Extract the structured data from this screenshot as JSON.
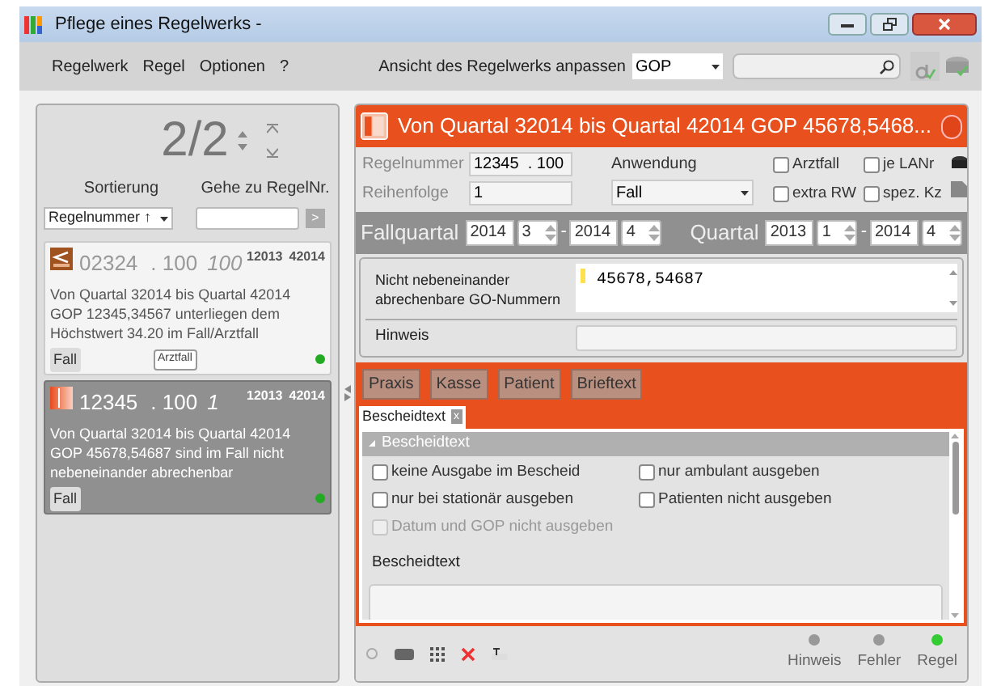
{
  "window": {
    "title": "Pflege eines Regelwerks -"
  },
  "menu": [
    {
      "label": "Regelwerk"
    },
    {
      "label": "Regel"
    },
    {
      "label": "Optionen"
    },
    {
      "label": "?"
    }
  ],
  "view": {
    "label": "Ansicht des Regelwerks anpassen",
    "value": "GOP"
  },
  "list_panel": {
    "counter": "2/2",
    "sort_label": "Sortierung",
    "sort_value": "Regelnummer ↑",
    "goto_label": "Gehe zu RegelNr.",
    "goto_button": ">"
  },
  "rules": [
    {
      "kind": "limit",
      "code": "02324",
      "suffix": ". 100",
      "number": "100",
      "from": "12013",
      "to": "42014",
      "text": "Von Quartal 32014 bis Quartal 42014 GOP 12345,34567 unterliegen dem Höchstwert 34.20 im Fall/Arztfall",
      "tags": [
        {
          "label": "Fall",
          "kind": "flat"
        },
        {
          "label": "Arztfall",
          "kind": "outlined"
        }
      ],
      "selected": false,
      "color": "#22aa22"
    },
    {
      "kind": "exclusion",
      "code": "12345",
      "suffix": ". 100",
      "number": "1",
      "from": "12013",
      "to": "42014",
      "text": "Von Quartal 32014 bis Quartal 42014 GOP 45678,54687 sind  im Fall nicht nebeneinander abrechenbar",
      "tags": [
        {
          "label": "Fall",
          "kind": "flat"
        }
      ],
      "selected": true,
      "color": "#22aa22"
    }
  ],
  "detail": {
    "title": "Von Quartal 32014 bis Quartal 42014 GOP 45678,5468...",
    "regelnummer": {
      "label": "Regelnummer",
      "value": "12345  . 100"
    },
    "reihenfolge": {
      "label": "Reihenfolge",
      "value": "1"
    },
    "anwendung": {
      "label": "Anwendung",
      "value": "Fall"
    },
    "flags": [
      {
        "label": "Arztfall",
        "checked": false
      },
      {
        "label": "je LANr",
        "checked": false
      },
      {
        "label": "extra RW",
        "checked": false
      },
      {
        "label": "spez. Kz",
        "checked": false
      }
    ],
    "fallquartal": {
      "label": "Fallquartal",
      "from_year": "2014",
      "from_q": "3",
      "sep": "-",
      "to_year": "2014",
      "to_q": "4"
    },
    "quartal": {
      "label": "Quartal",
      "from_year": "2013",
      "from_q": "1",
      "sep": "-",
      "to_year": "2014",
      "to_q": "4"
    },
    "gop": {
      "label": "Nicht nebeneinander abrechenbare GO-Nummern",
      "value": "45678,54687"
    },
    "hinweis": {
      "label": "Hinweis"
    },
    "sections": [
      {
        "label": "Praxis"
      },
      {
        "label": "Kasse"
      },
      {
        "label": "Patient"
      },
      {
        "label": "Brieftext"
      }
    ],
    "doc_tab": {
      "label": "Bescheidtext",
      "close": "x"
    },
    "group": {
      "title": "Bescheidtext",
      "options": [
        {
          "label": "keine Ausgabe im Bescheid",
          "checked": false,
          "disabled": false
        },
        {
          "label": "nur ambulant ausgeben",
          "checked": false,
          "disabled": false
        },
        {
          "label": "nur bei stationär ausgeben",
          "checked": false,
          "disabled": false
        },
        {
          "label": "Patienten nicht ausgeben",
          "checked": false,
          "disabled": false
        },
        {
          "label": "Datum und GOP nicht ausgeben",
          "checked": false,
          "disabled": true
        }
      ],
      "text_label": "Bescheidtext"
    }
  },
  "status_lights": [
    {
      "label": "Hinweis",
      "on": false
    },
    {
      "label": "Fehler",
      "on": false
    },
    {
      "label": "Regel",
      "on": true
    }
  ]
}
